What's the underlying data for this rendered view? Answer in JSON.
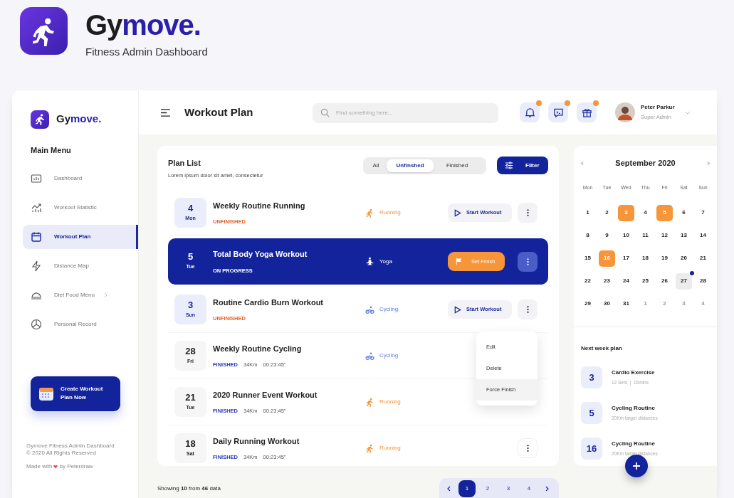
{
  "hero": {
    "name_parts": [
      "Gy",
      "move."
    ],
    "subtitle": "Fitness Admin Dashboard"
  },
  "sidebar": {
    "brand_parts": [
      "Gy",
      "move."
    ],
    "heading": "Main Menu",
    "items": [
      {
        "label": "Dashboard",
        "selected": false,
        "has_submenu": false
      },
      {
        "label": "Workout Statistic",
        "selected": false,
        "has_submenu": false
      },
      {
        "label": "Workout Plan",
        "selected": true,
        "has_submenu": false
      },
      {
        "label": "Distance Map",
        "selected": false,
        "has_submenu": false
      },
      {
        "label": "Diet Food Menu",
        "selected": false,
        "has_submenu": true
      },
      {
        "label": "Personal Record",
        "selected": false,
        "has_submenu": false
      }
    ],
    "cta": "Create Workout Plan Now",
    "footer": [
      "Gymove Fitness Admin Dashboard",
      "© 2020 All Rights Reserved"
    ],
    "made_with": [
      "Made with",
      "by Peterdraw"
    ]
  },
  "topbar": {
    "title": "Workout Plan",
    "search_placeholder": "Find something here...",
    "notifications": [
      {
        "badge": true
      },
      {
        "badge": true
      },
      {
        "badge": true
      }
    ],
    "user": {
      "name": "Peter Parkur",
      "role": "Super Admin"
    }
  },
  "plan_list": {
    "title": "Plan List",
    "subtitle": "Lorem ipsum dolor sit amet, consectetur",
    "filters": [
      {
        "label": "All",
        "selected": false
      },
      {
        "label": "Unfinshed",
        "selected": true
      },
      {
        "label": "Finished",
        "selected": false
      }
    ],
    "filter_button": "Filter",
    "rows": [
      {
        "day": "4",
        "weekday": "Mon",
        "title": "Weekly Routine Running",
        "status": {
          "label": "UNFINISHED",
          "kind": "unfinished"
        },
        "category": {
          "label": "Running",
          "kind": "running"
        },
        "action": {
          "label": "Start Workout",
          "kind": "start"
        },
        "menu_button": true,
        "selected": false
      },
      {
        "day": "5",
        "weekday": "Tue",
        "title": "Total Body Yoga Workout",
        "status": {
          "label": "ON PROGRESS",
          "kind": "progress"
        },
        "category": {
          "label": "Yoga",
          "kind": "yoga"
        },
        "action": {
          "label": "Set Finish",
          "kind": "finish"
        },
        "menu_button": true,
        "selected": true
      },
      {
        "day": "3",
        "weekday": "Sun",
        "title": "Routine Cardio Burn Workout",
        "status": {
          "label": "UNFINISHED",
          "kind": "unfinished"
        },
        "category": {
          "label": "Cycling",
          "kind": "cycling"
        },
        "action": {
          "label": "Start Workout",
          "kind": "start"
        },
        "menu_button": true,
        "selected": false
      },
      {
        "day": "28",
        "weekday": "Fri",
        "title": "Weekly Routine Cycling",
        "status": {
          "label": "FINISHED",
          "kind": "finished"
        },
        "distance": "34Km",
        "duration": "00:23:45\"",
        "category": {
          "label": "Cycling",
          "kind": "cycling"
        },
        "menu_button": false,
        "selected": false
      },
      {
        "day": "21",
        "weekday": "Tue",
        "title": "2020 Runner Event Workout",
        "status": {
          "label": "FINISHED",
          "kind": "finished"
        },
        "distance": "34Km",
        "duration": "00:23:45\"",
        "category": {
          "label": "Running",
          "kind": "running"
        },
        "menu_button": false,
        "selected": false
      },
      {
        "day": "18",
        "weekday": "Sat",
        "title": "Daily Running Workout",
        "status": {
          "label": "FINISHED",
          "kind": "finished"
        },
        "distance": "34Km",
        "duration": "00:23:45\"",
        "category": {
          "label": "Running",
          "kind": "running"
        },
        "menu_button": true,
        "selected": false
      }
    ],
    "context_menu": [
      {
        "label": "Edit",
        "selected": false
      },
      {
        "label": "Delete",
        "selected": false
      },
      {
        "label": "Force Finish",
        "selected": true
      }
    ]
  },
  "pagination": {
    "summary": "Showing **10** from **46** data",
    "pages": [
      {
        "label": "1",
        "selected": true
      },
      {
        "label": "2",
        "selected": false
      },
      {
        "label": "3",
        "selected": false
      },
      {
        "label": "4",
        "selected": false
      }
    ]
  },
  "calendar": {
    "month": "September 2020",
    "weekdays": [
      "Mon",
      "Tue",
      "Wed",
      "Thu",
      "Fri",
      "Sat",
      "Sun"
    ],
    "days": [
      {
        "label": "1",
        "kind": "day"
      },
      {
        "label": "2",
        "kind": "day"
      },
      {
        "label": "3",
        "kind": "event"
      },
      {
        "label": "4",
        "kind": "day"
      },
      {
        "label": "5",
        "kind": "event"
      },
      {
        "label": "6",
        "kind": "day"
      },
      {
        "label": "7",
        "kind": "day"
      },
      {
        "label": "8",
        "kind": "day"
      },
      {
        "label": "9",
        "kind": "day"
      },
      {
        "label": "10",
        "kind": "day"
      },
      {
        "label": "11",
        "kind": "day"
      },
      {
        "label": "12",
        "kind": "day"
      },
      {
        "label": "13",
        "kind": "day"
      },
      {
        "label": "14",
        "kind": "day"
      },
      {
        "label": "15",
        "kind": "day"
      },
      {
        "label": "16",
        "kind": "event"
      },
      {
        "label": "17",
        "kind": "day"
      },
      {
        "label": "18",
        "kind": "day"
      },
      {
        "label": "19",
        "kind": "day"
      },
      {
        "label": "20",
        "kind": "day"
      },
      {
        "label": "21",
        "kind": "day"
      },
      {
        "label": "22",
        "kind": "day"
      },
      {
        "label": "23",
        "kind": "day"
      },
      {
        "label": "24",
        "kind": "day"
      },
      {
        "label": "25",
        "kind": "day"
      },
      {
        "label": "26",
        "kind": "day"
      },
      {
        "label": "27",
        "kind": "today"
      },
      {
        "label": "28",
        "kind": "day"
      },
      {
        "label": "29",
        "kind": "day"
      },
      {
        "label": "30",
        "kind": "day"
      },
      {
        "label": "31",
        "kind": "day"
      },
      {
        "label": "1",
        "kind": "outside"
      },
      {
        "label": "2",
        "kind": "outside"
      },
      {
        "label": "3",
        "kind": "outside"
      },
      {
        "label": "4",
        "kind": "outside"
      }
    ]
  },
  "next_week": {
    "title": "Next week plan",
    "items": [
      {
        "day": "3",
        "title": "Cardio Exercise",
        "detail": "12 Sets  |  16mins"
      },
      {
        "day": "5",
        "title": "Cycling Routine",
        "detail": "20Km target distances"
      },
      {
        "day": "16",
        "title": "Cycling Routine",
        "detail": "20Km target distances"
      }
    ]
  }
}
